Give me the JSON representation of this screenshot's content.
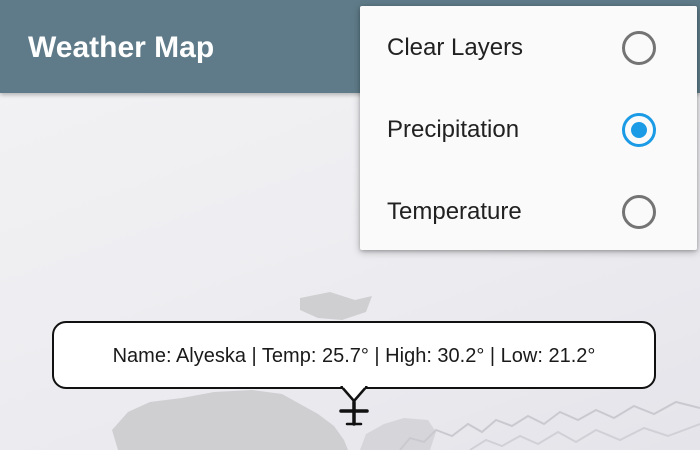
{
  "app": {
    "title": "Weather Map"
  },
  "layer_menu": {
    "items": [
      {
        "label": "Clear Layers",
        "selected": false
      },
      {
        "label": "Precipitation",
        "selected": true
      },
      {
        "label": "Temperature",
        "selected": false
      }
    ]
  },
  "location_callout": {
    "text": "Name: Alyeska | Temp: 25.7° | High: 30.2° | Low: 21.2°"
  },
  "colors": {
    "app_bar": "#5f7b89",
    "radio_selected": "#1b9be6",
    "radio_unselected": "#747474",
    "land": "#cfcfd2"
  },
  "icons": {
    "location_marker": "crosshair-marker-icon"
  }
}
